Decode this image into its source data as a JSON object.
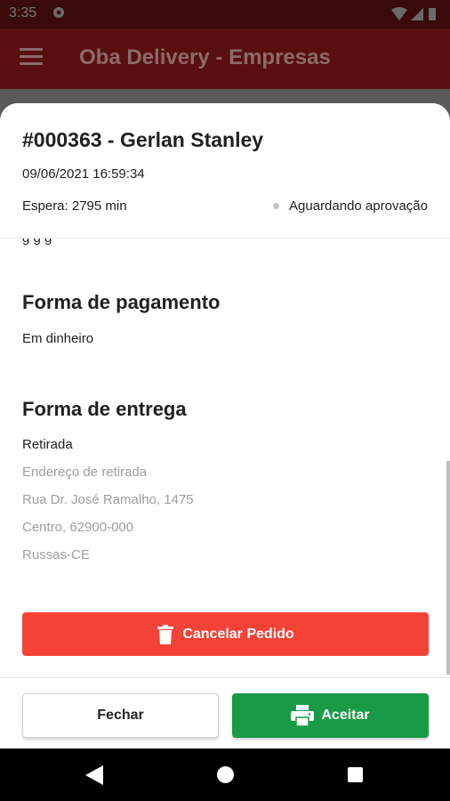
{
  "status_bar": {
    "time": "3:35"
  },
  "app_bar": {
    "title": "Oba Delivery - Empresas"
  },
  "order": {
    "title": "#000363 - Gerlan Stanley",
    "datetime": "09/06/2021 16:59:34",
    "wait": "Espera: 2795 min",
    "status": "Aguardando aprovação"
  },
  "payment": {
    "title": "Forma de pagamento",
    "method": "Em dinheiro"
  },
  "delivery": {
    "title": "Forma de entrega",
    "type": "Retirada",
    "address_label": "Endereço de retirada",
    "street": "Rua Dr. José Ramalho, 1475",
    "district": "Centro, 62900-000",
    "city": "Russas-CE"
  },
  "actions": {
    "cancel_label": "Cancelar Pedido",
    "close_label": "Fechar",
    "accept_label": "Aceitar"
  },
  "colors": {
    "cancel": "#f44336",
    "accept": "#189a46",
    "app_bar": "#b71c1c"
  },
  "icons": [
    "settings-icon",
    "wifi-icon",
    "signal-icon",
    "battery-icon",
    "menu-icon",
    "trash-icon",
    "printer-icon",
    "back-icon",
    "home-icon",
    "recents-icon"
  ]
}
